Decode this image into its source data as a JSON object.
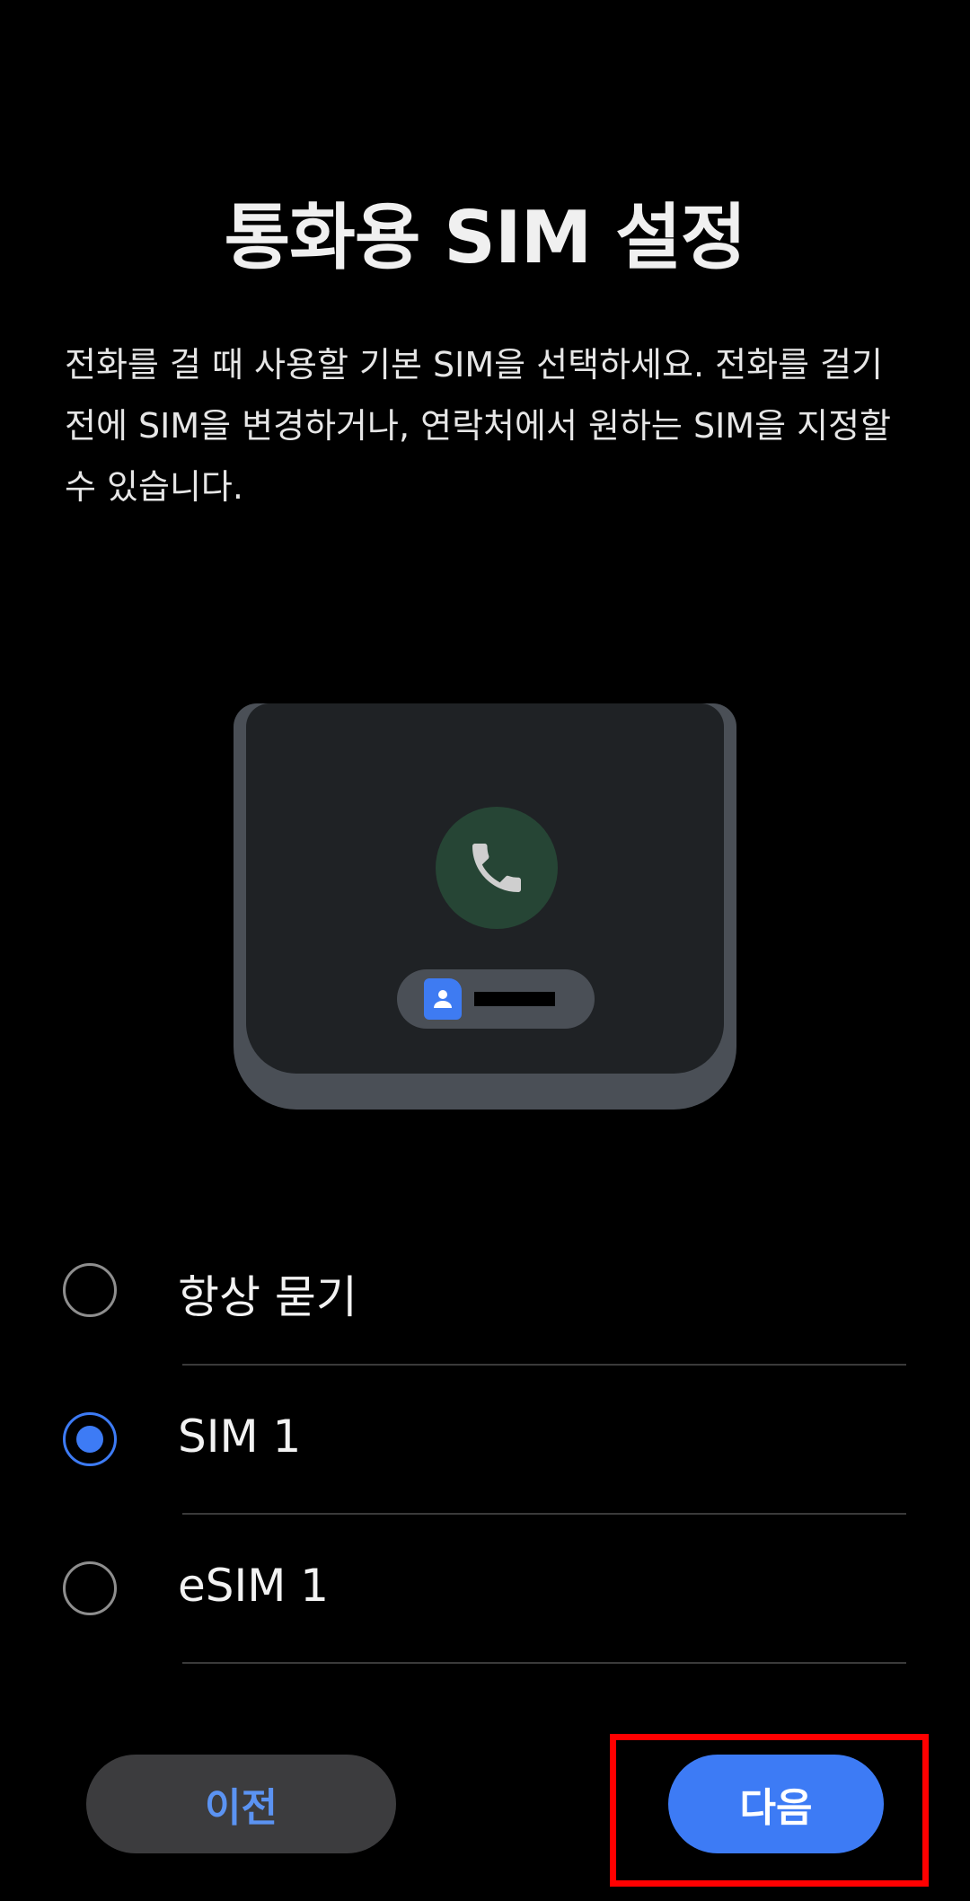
{
  "page": {
    "title": "통화용 SIM 설정",
    "description": "전화를 걸 때 사용할 기본 SIM을 선택하세요. 전화를 걸기 전에 SIM을 변경하거나, 연락처에서 원하는 SIM을 지정할 수 있습니다."
  },
  "illustration": {
    "call_icon": "phone-icon",
    "contact_icon": "contact-card-icon"
  },
  "options": [
    {
      "label": "항상 묻기",
      "checked": false
    },
    {
      "label": "SIM 1",
      "checked": true
    },
    {
      "label": "eSIM 1",
      "checked": false
    }
  ],
  "buttons": {
    "prev_label": "이전",
    "next_label": "다음"
  },
  "colors": {
    "accent": "#3d7bf5",
    "background": "#000000",
    "highlight": "#ff0000"
  }
}
